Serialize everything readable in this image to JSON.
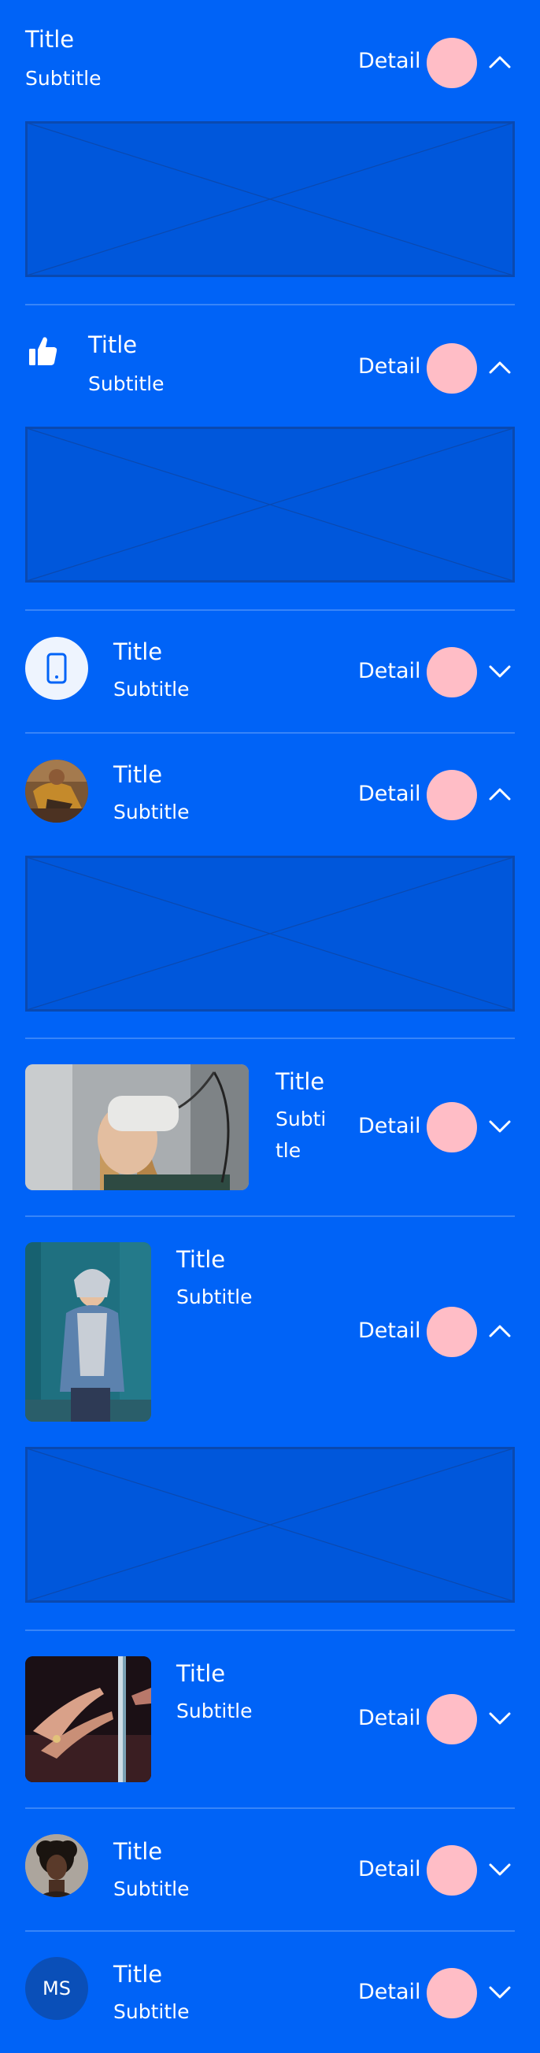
{
  "colors": {
    "background": "#0063F7",
    "accent_dot": "#FFBDC6",
    "divider": "#ffffff"
  },
  "items": [
    {
      "title": "Title",
      "subtitle": "Subtitle",
      "detail": "Detail",
      "leading": "none",
      "expanded": true,
      "chevron": "chevron-up-icon"
    },
    {
      "title": "Title",
      "subtitle": "Subtitle",
      "detail": "Detail",
      "leading": "thumbs-up-icon",
      "expanded": true,
      "chevron": "chevron-up-icon"
    },
    {
      "title": "Title",
      "subtitle": "Subtitle",
      "detail": "Detail",
      "leading": "phone-icon",
      "expanded": false,
      "chevron": "chevron-down-icon"
    },
    {
      "title": "Title",
      "subtitle": "Subtitle",
      "detail": "Detail",
      "leading": "avatar-photo",
      "expanded": true,
      "chevron": "chevron-up-icon"
    },
    {
      "title": "Title",
      "subtitle": "Subti tle",
      "detail": "Detail",
      "leading": "landscape-photo",
      "expanded": false,
      "chevron": "chevron-down-icon"
    },
    {
      "title": "Title",
      "subtitle": "Subtitle",
      "detail": "Detail",
      "leading": "portrait-photo",
      "expanded": true,
      "chevron": "chevron-up-icon"
    },
    {
      "title": "Title",
      "subtitle": "Subtitle",
      "detail": "Detail",
      "leading": "square-photo",
      "expanded": false,
      "chevron": "chevron-down-icon"
    },
    {
      "title": "Title",
      "subtitle": "Subtitle",
      "detail": "Detail",
      "leading": "avatar-photo",
      "expanded": false,
      "chevron": "chevron-down-icon"
    },
    {
      "title": "Title",
      "subtitle": "Subtitle",
      "detail": "Detail",
      "leading": "initials-avatar",
      "initials": "MS",
      "expanded": false,
      "chevron": "chevron-down-icon"
    }
  ]
}
